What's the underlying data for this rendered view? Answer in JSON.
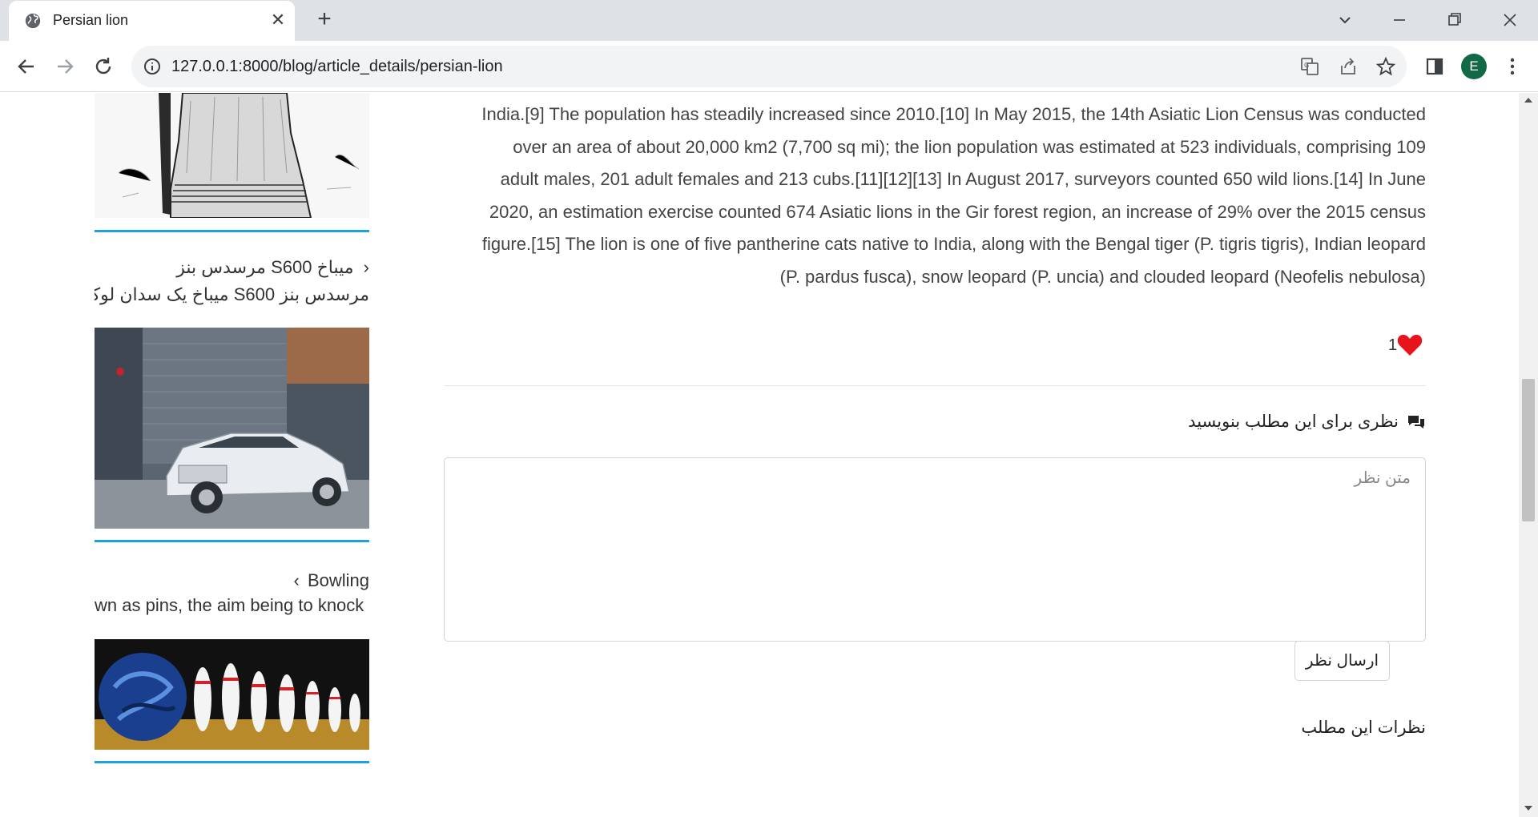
{
  "browser": {
    "tab_title": "Persian lion",
    "url": "127.0.0.1:8000/blog/article_details/persian-lion",
    "profile_initial": "E"
  },
  "sidebar": {
    "items": [
      {
        "title": "مرسدس بنز S600 میباخ",
        "subtitle": "مرسدس بنز S600 میباخ یک سدان لوک",
        "image": "mercedes-car-image"
      },
      {
        "title": "Bowling",
        "subtitle": "wn as pins, the aim being to knock",
        "image": "bowling-image"
      }
    ]
  },
  "article": {
    "paragraph_lines": [
      "India.[9] The population has steadily increased since 2010.[10] In May 2015, the 14th Asiatic Lion Census was conducted",
      "over an area of about 20,000 km2 (7,700 sq mi); the lion population was estimated at 523 individuals, comprising 109",
      "adult males, 201 adult females and 213 cubs.[11][12][13] In August 2017, surveyors counted 650 wild lions.[14] In June",
      "2020, an estimation exercise counted 674 Asiatic lions in the Gir forest region, an increase of 29% over the 2015 census",
      "figure.[15] The lion is one of five pantherine cats native to India, along with the Bengal tiger (P. tigris tigris), Indian leopard",
      "(P. pardus fusca), snow leopard (P. uncia) and clouded leopard (Neofelis nebulosa)"
    ],
    "like_count": "1"
  },
  "comments": {
    "heading": "نظری برای این مطلب بنویسید",
    "placeholder": "متن نظر",
    "submit_label": "ارسال نظر",
    "list_title": "نظرات این مطلب"
  },
  "colors": {
    "divider": "#1da1e0",
    "like_heart": "#e8141b"
  }
}
